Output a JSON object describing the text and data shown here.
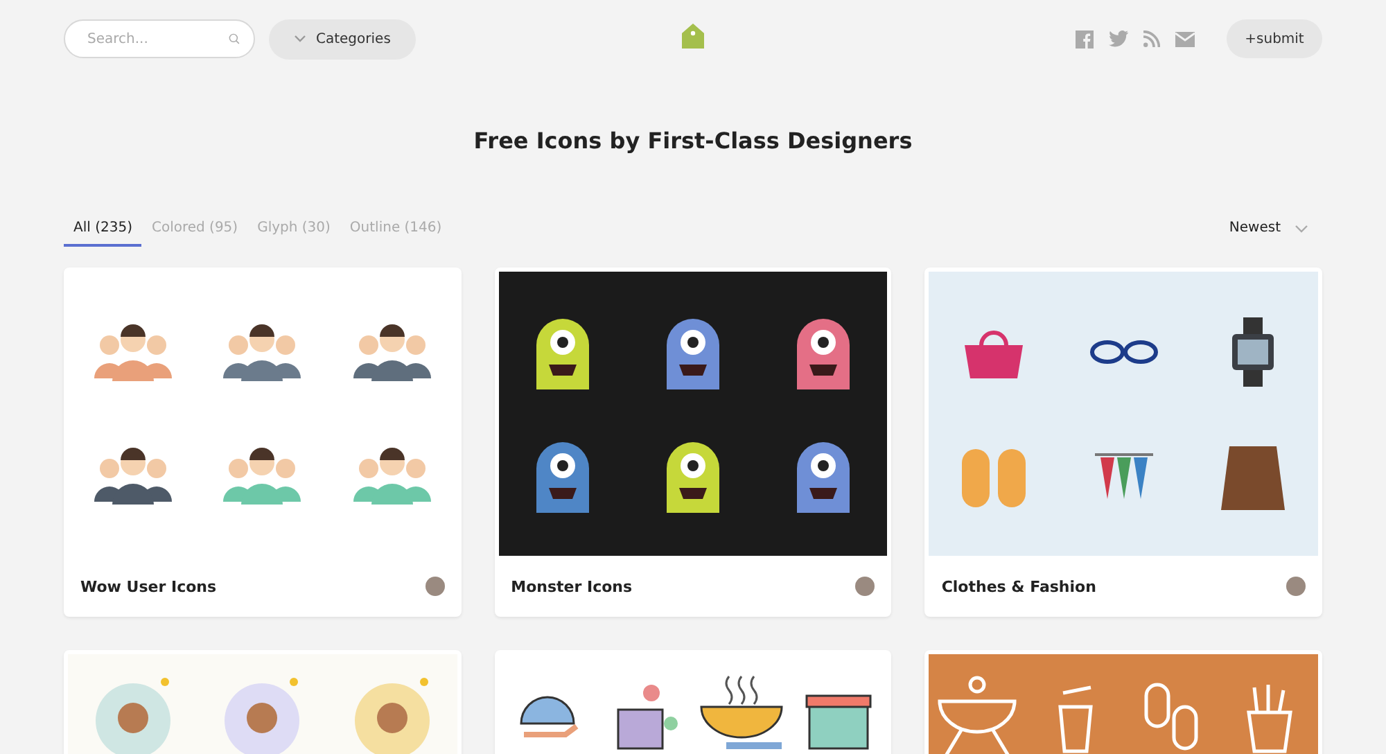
{
  "header": {
    "search": {
      "placeholder": "Search..."
    },
    "categories": "Categories",
    "submit": "+submit"
  },
  "title": "Free Icons by First-Class Designers",
  "tabs": [
    {
      "label": "All (235)",
      "selected": true
    },
    {
      "label": "Colored (95)",
      "selected": false
    },
    {
      "label": "Glyph (30)",
      "selected": false
    },
    {
      "label": "Outline (146)",
      "selected": false
    }
  ],
  "sort": "Newest",
  "cards": [
    {
      "title": "Wow User Icons",
      "kind": "people"
    },
    {
      "title": "Monster Icons",
      "kind": "monsters"
    },
    {
      "title": "Clothes & Fashion",
      "kind": "clothes"
    },
    {
      "kind": "avatars"
    },
    {
      "kind": "food"
    },
    {
      "kind": "summer"
    }
  ]
}
